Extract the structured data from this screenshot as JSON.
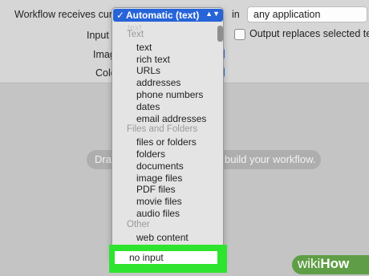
{
  "options": {
    "receives_label": "Workflow receives curren",
    "input_label": "Input i",
    "image_label": "Imag",
    "color_label": "Colo",
    "in_label": "in",
    "application_value": "any application",
    "output_replaces_label": "Output replaces selected text",
    "output_replaces_checked": false
  },
  "popup": {
    "selected_check": "✓",
    "selected_value": "Automatic (text)",
    "faded_item": "text",
    "sections": [
      {
        "title": "Text",
        "items": [
          "text",
          "rich text",
          "URLs",
          "addresses",
          "phone numbers",
          "dates",
          "email addresses"
        ]
      },
      {
        "title": "Files and Folders",
        "items": [
          "files or folders",
          "folders",
          "documents",
          "image files",
          "PDF files",
          "movie files",
          "audio files"
        ]
      },
      {
        "title": "Other",
        "items": [
          "web content"
        ]
      }
    ],
    "highlighted_item": "no input",
    "highlight_color": "#2ee42e"
  },
  "workflow": {
    "hint_left": "Dra",
    "hint_right": "build your workflow."
  },
  "watermark": {
    "wiki": "wiki",
    "how": "How"
  }
}
